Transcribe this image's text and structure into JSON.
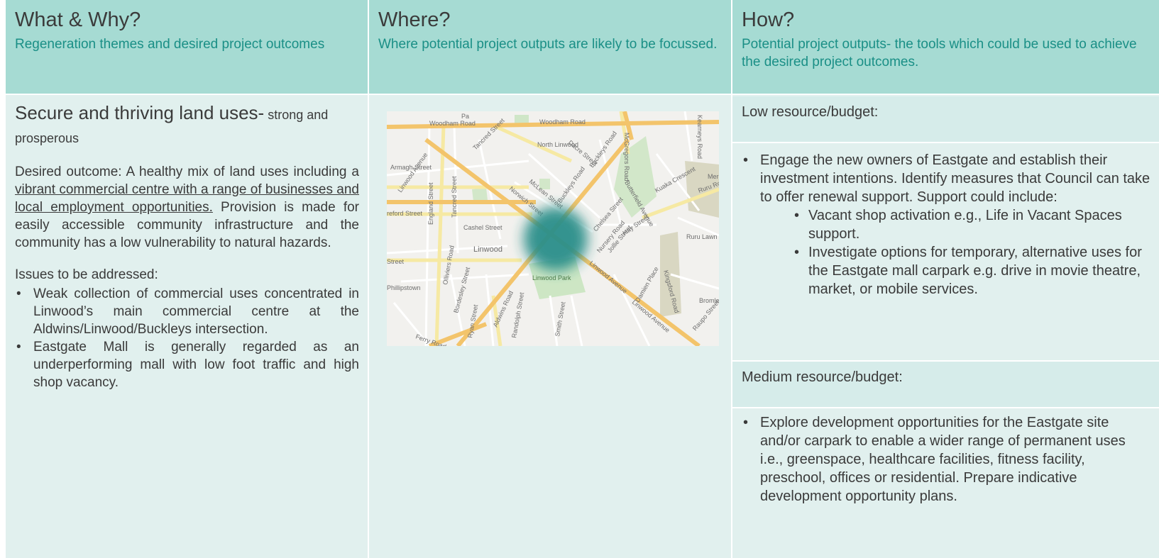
{
  "columns": [
    {
      "title": "What & Why?",
      "subtitle": "Regeneration themes and desired project outcomes"
    },
    {
      "title": "Where?",
      "subtitle": "Where potential project outputs are likely to be focussed."
    },
    {
      "title": "How?",
      "subtitle": "Potential project outputs- the tools which could be used to achieve the desired project outcomes."
    }
  ],
  "theme": {
    "main": "Secure and thriving land uses-",
    "tail": " strong and prosperous"
  },
  "desired": {
    "lead": "Desired outcome: A  healthy mix of land uses including a ",
    "underlined": "vibrant commercial centre with a range of businesses and local employment opportunities.",
    "rest": " Provision is made for easily accessible community infrastructure and the community has a low vulnerability to natural hazards."
  },
  "issues": {
    "heading": "Issues to be addressed:",
    "items": [
      "Weak collection of commercial uses concentrated in Linwood’s main commercial centre at the Aldwins/Linwood/Buckleys intersection.",
      "Eastgate Mall is generally regarded as an underperforming mall with low foot traffic and high shop vacancy."
    ]
  },
  "map": {
    "labels": [
      "Woodham Road",
      "Woodham Road",
      "North Linwood",
      "Dacre Street",
      "Armagh Street",
      "Tancred Street",
      "Tancred Street",
      "McLean Street",
      "Buckleys Road",
      "Buckleys Road",
      "Butterfield Avenue",
      "McGregors Road",
      "Kearneys Road",
      "Kuaka Crescent",
      "Ruru Road",
      "Hay Street",
      "Ruru Lawn C",
      "Nursery Road",
      "Norwich Street",
      "Chelsea Street",
      "Jollie Street",
      "England Street",
      "Cashel Street",
      "Linwood",
      "Linwood Park",
      "Olliviers Road",
      "Bordesley Street",
      "Aldwins Road",
      "Ryan Street",
      "Randolph Street",
      "Smith Street",
      "Linwood Avenue",
      "Linwood Avenue",
      "Linwood Avenue",
      "Damien Place",
      "Kingsford Road",
      "Raupo Street",
      "Bromley",
      "Phillipstown",
      "Ferry Road",
      "Street",
      "reford Street",
      "Pa",
      "Merc"
    ]
  },
  "how": {
    "low_label": "Low resource/budget:",
    "low_item": "Engage the new owners of Eastgate and establish their investment intentions. Identify measures that Council can take to offer renewal support. Support could include:",
    "low_sub": [
      "Vacant shop activation e.g., Life in Vacant Spaces support.",
      "Investigate options for temporary, alternative uses for the Eastgate mall carpark e.g.  drive in movie theatre, market, or mobile services."
    ],
    "medium_label": "Medium resource/budget:",
    "medium_item": "Explore development opportunities for the Eastgate site and/or carpark to enable a wider range of permanent uses  i.e., greenspace, healthcare facilities, fitness facility, preschool, offices or residential. Prepare indicative development opportunity plans."
  },
  "colors": {
    "header_bg": "#a6dbd3",
    "body_bg": "#e1f0ee",
    "accent_text": "#1a8f86",
    "focus_blob": "#2a8f8a"
  }
}
